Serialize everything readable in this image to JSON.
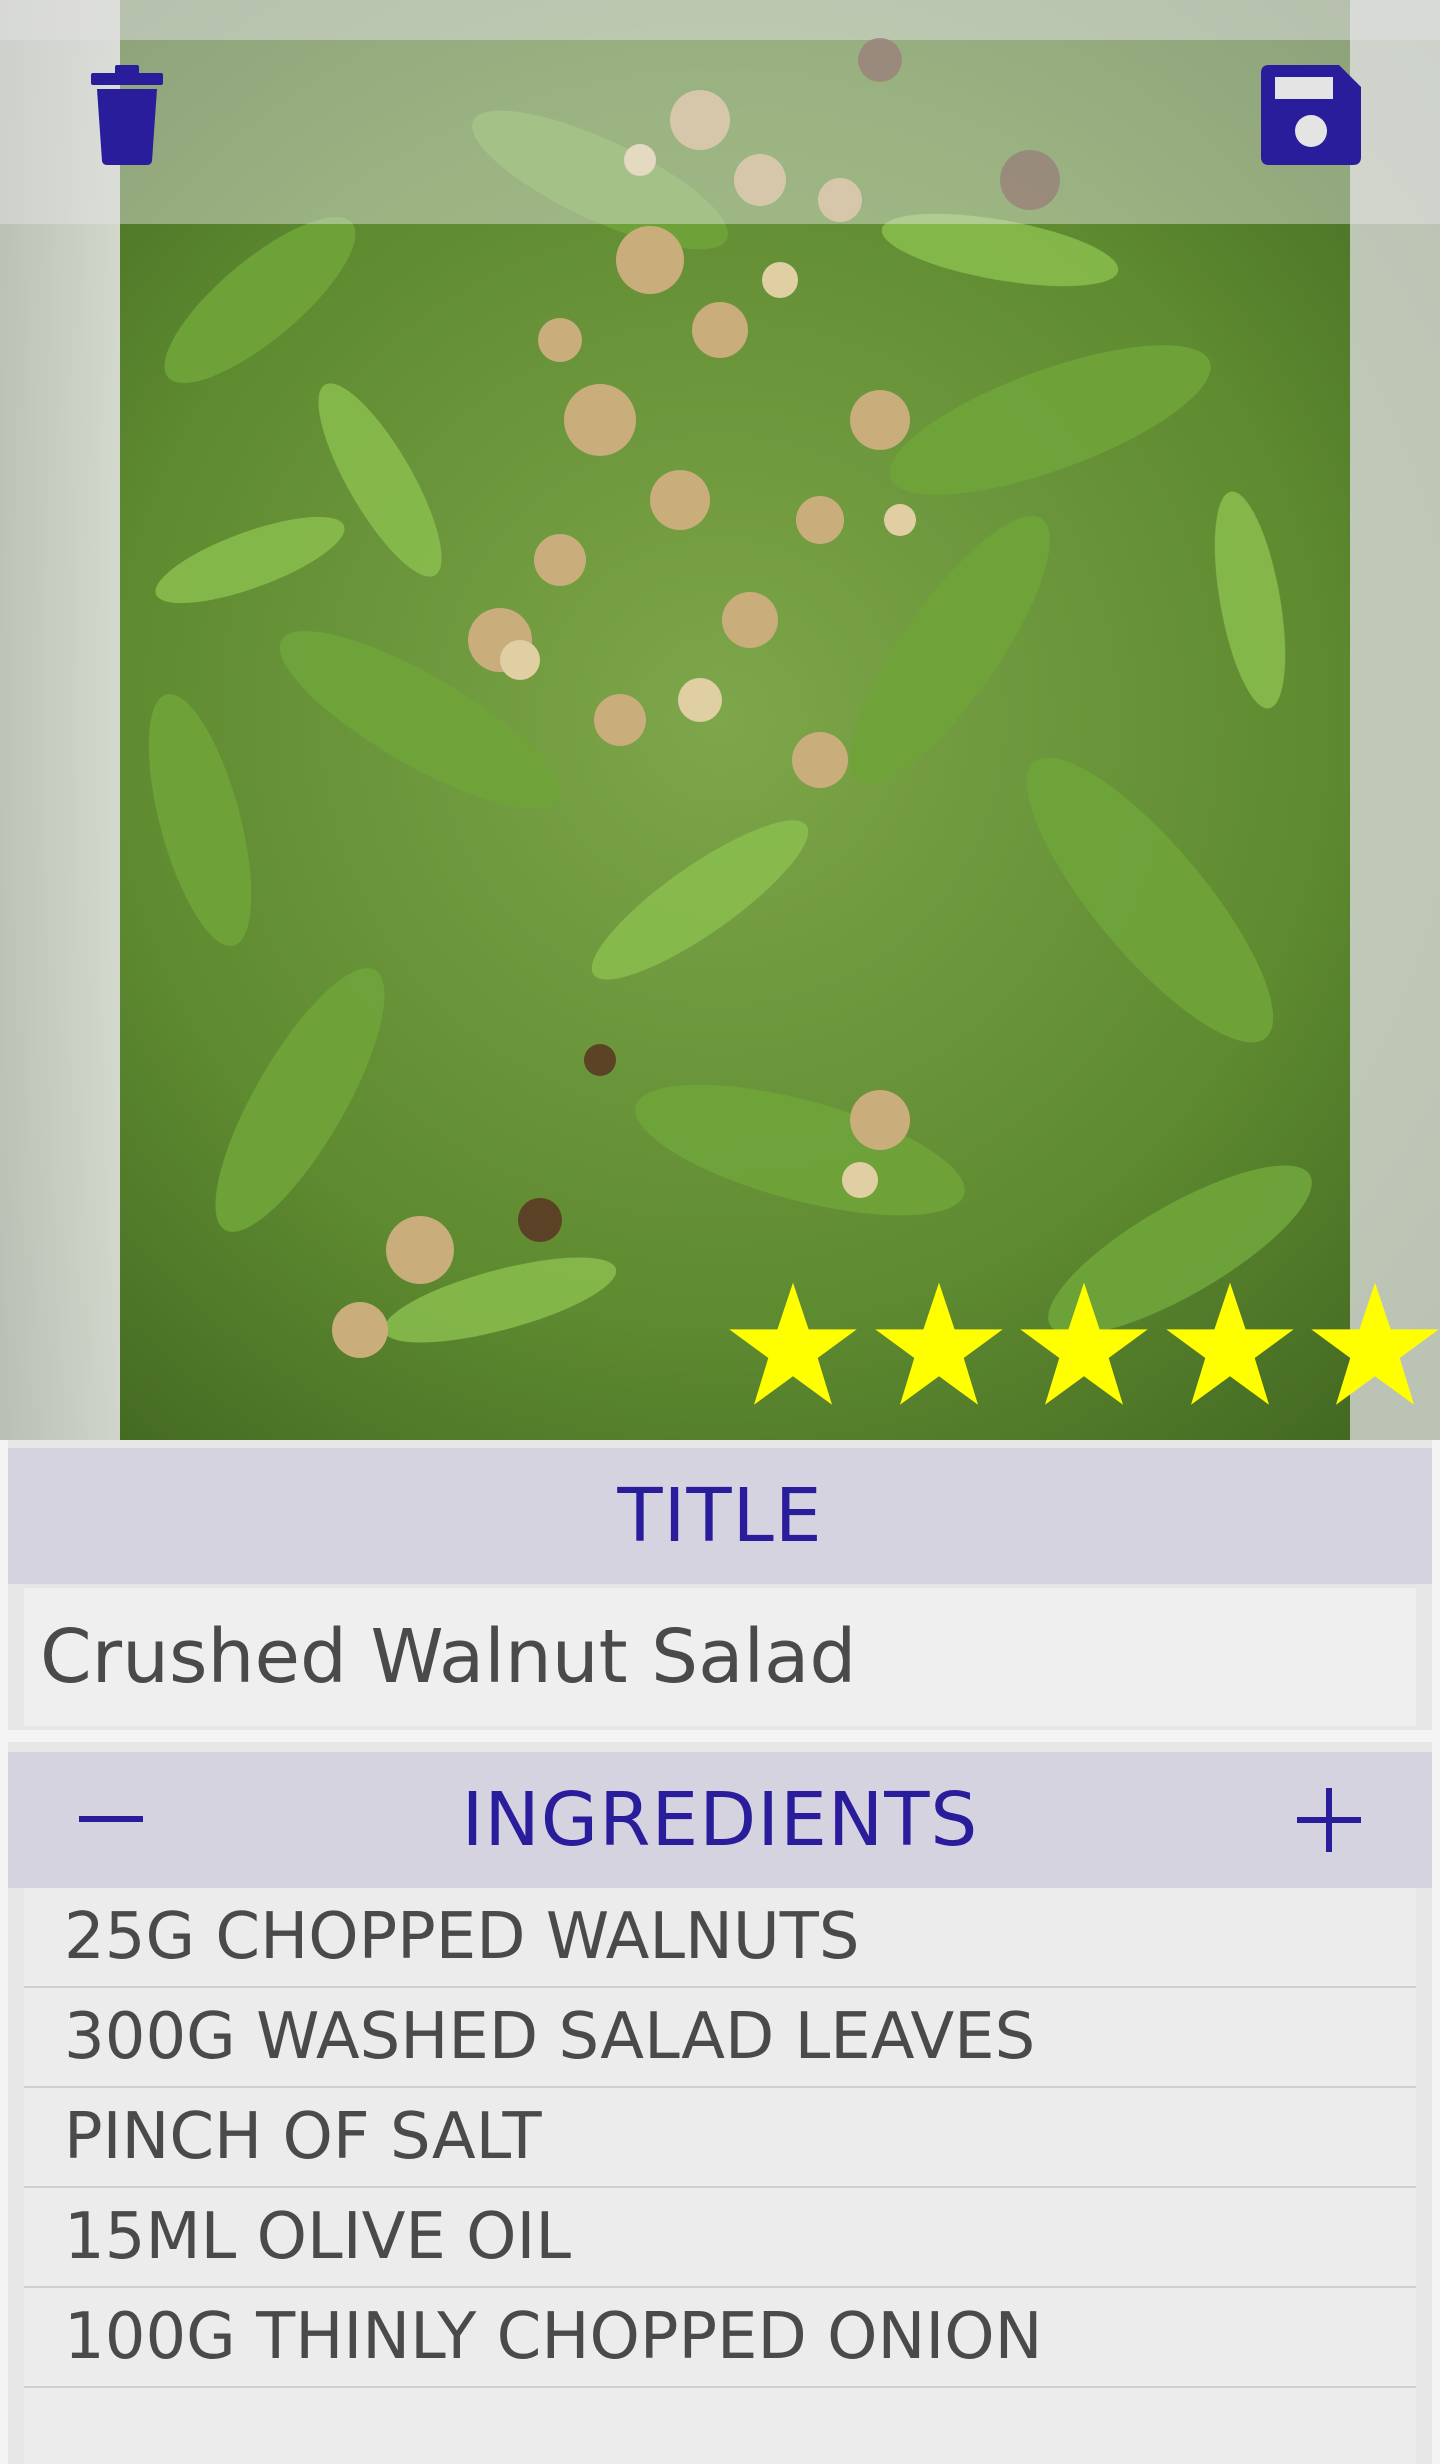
{
  "photo": {
    "description_icon": "salad-photo",
    "rating": 5,
    "rating_max": 5,
    "star_color": "#ffff00"
  },
  "toolbar": {
    "delete_icon": "trash-icon",
    "save_icon": "floppy-disk-icon",
    "icon_color": "#2a1d9c"
  },
  "title_section": {
    "header": "TITLE",
    "value": "Crushed Walnut Salad"
  },
  "ingredients_section": {
    "header": "INGREDIENTS",
    "remove_icon": "minus-icon",
    "add_icon": "plus-icon",
    "items": [
      "25G CHOPPED WALNUTS",
      "300G WASHED SALAD LEAVES",
      "PINCH OF SALT",
      "15ML OLIVE OIL",
      "100G THINLY CHOPPED ONION"
    ]
  },
  "colors": {
    "accent": "#2a1d9c",
    "header_bg": "#d5d3e0",
    "field_bg": "#efefef",
    "text": "#4a4a4a"
  }
}
